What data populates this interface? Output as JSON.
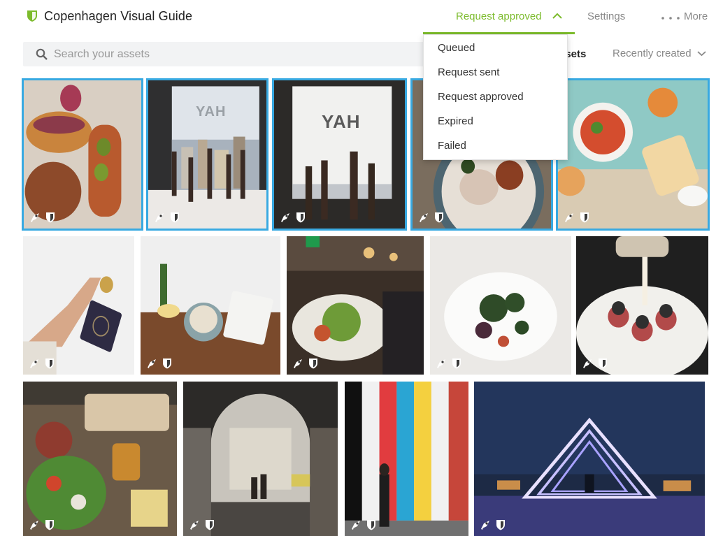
{
  "app": {
    "title": "Copenhagen Visual Guide",
    "brand_color": "#7cbb2c",
    "logo_icon": "shield-icon"
  },
  "nav": {
    "filter_label": "Request approved",
    "settings_label": "Settings",
    "more_label": "More"
  },
  "search": {
    "placeholder": "Search your assets",
    "value": ""
  },
  "toolbar": {
    "assets_label": "ssets",
    "sort_label": "Recently created"
  },
  "dropdown": {
    "items": [
      "Queued",
      "Request sent",
      "Request approved",
      "Expired",
      "Failed"
    ]
  },
  "selection_color": "#38a9e1",
  "tiles": [
    {
      "subject": "food-sandwiches",
      "selected": true,
      "badges": [
        "rocket-icon",
        "shield-icon"
      ]
    },
    {
      "subject": "window-yah-hands",
      "selected": true,
      "badges": [
        "rocket-icon",
        "shield-icon"
      ]
    },
    {
      "subject": "window-yah-hands-close",
      "selected": true,
      "badges": [
        "rocket-icon",
        "shield-icon"
      ]
    },
    {
      "subject": "food-bowl",
      "selected": true,
      "badges": [
        "rocket-icon",
        "shield-icon"
      ]
    },
    {
      "subject": "food-salad-drinks",
      "selected": true,
      "badges": [
        "rocket-icon",
        "shield-icon"
      ]
    },
    {
      "subject": "hand-coin",
      "selected": false,
      "badges": [
        "rocket-icon",
        "shield-icon"
      ]
    },
    {
      "subject": "cafe-table-bowl",
      "selected": false,
      "badges": [
        "rocket-icon",
        "shield-icon"
      ]
    },
    {
      "subject": "food-hall",
      "selected": false,
      "badges": [
        "rocket-icon",
        "shield-icon"
      ]
    },
    {
      "subject": "plated-dish",
      "selected": false,
      "badges": [
        "rocket-icon",
        "shield-icon"
      ]
    },
    {
      "subject": "dessert-pour",
      "selected": false,
      "badges": [
        "rocket-icon",
        "shield-icon"
      ]
    },
    {
      "subject": "food-table-spread",
      "selected": false,
      "badges": [
        "rocket-icon",
        "shield-icon"
      ]
    },
    {
      "subject": "archway-street",
      "selected": false,
      "badges": [
        "rocket-icon",
        "shield-icon"
      ]
    },
    {
      "subject": "striped-wall-walker",
      "selected": false,
      "badges": [
        "rocket-icon",
        "shield-icon"
      ]
    },
    {
      "subject": "light-triangle-night",
      "selected": false,
      "badges": [
        "rocket-icon",
        "shield-icon"
      ]
    }
  ]
}
